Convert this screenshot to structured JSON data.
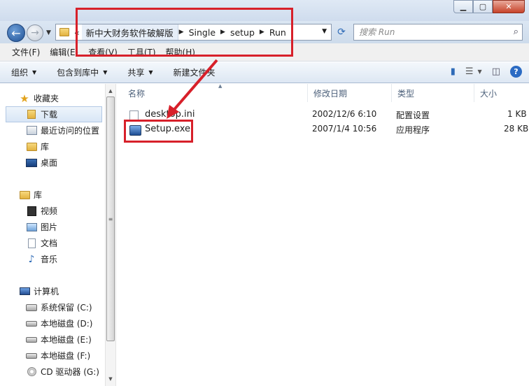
{
  "window": {
    "min_glyph": "▁",
    "max_glyph": "▢",
    "close_glyph": "✕"
  },
  "address": {
    "crumbs": [
      "新中大财务软件破解版",
      "Single",
      "setup",
      "Run"
    ],
    "overflow": "«"
  },
  "search": {
    "placeholder": "搜索 Run"
  },
  "menu": [
    "文件(F)",
    "编辑(E)",
    "查看(V)",
    "工具(T)",
    "帮助(H)"
  ],
  "toolbar": {
    "organize": "组织",
    "include_library": "包含到库中",
    "share": "共享",
    "new_folder": "新建文件夹"
  },
  "nav": {
    "favorites": {
      "title": "收藏夹",
      "items": [
        "下载",
        "最近访问的位置",
        "库",
        "桌面"
      ]
    },
    "libraries": {
      "title": "库",
      "items": [
        "视频",
        "图片",
        "文档",
        "音乐"
      ]
    },
    "computer": {
      "title": "计算机",
      "items": [
        "系统保留 (C:)",
        "本地磁盘 (D:)",
        "本地磁盘 (E:)",
        "本地磁盘 (F:)",
        "CD 驱动器 (G:)"
      ]
    }
  },
  "columns": {
    "name": "名称",
    "modified": "修改日期",
    "type": "类型",
    "size": "大小"
  },
  "files": [
    {
      "name": "desktop.ini",
      "modified": "2002/12/6 6:10",
      "type": "配置设置",
      "size": "1 KB",
      "icon": "settings-file-icon"
    },
    {
      "name": "Setup.exe",
      "modified": "2007/1/4 10:56",
      "type": "应用程序",
      "size": "28 KB",
      "icon": "setup-exe-icon"
    }
  ],
  "colors": {
    "highlight": "#d7202a",
    "accent": "#2b6bc3"
  }
}
